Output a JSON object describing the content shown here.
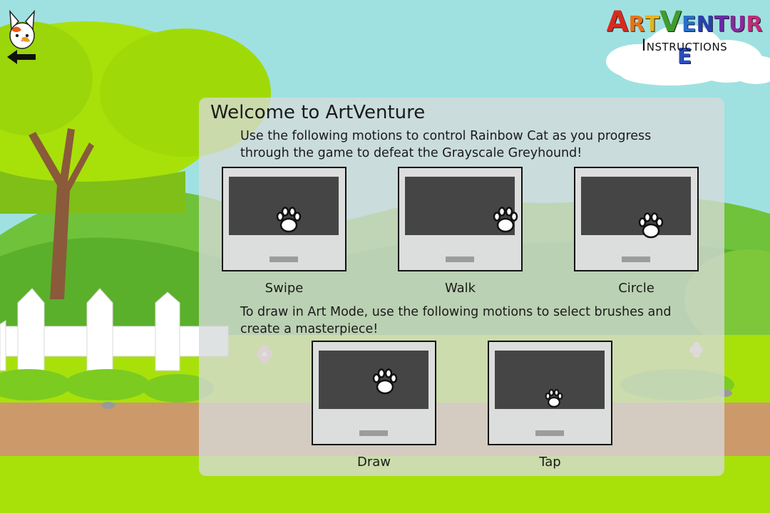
{
  "logo": {
    "title_letters": [
      {
        "ch": "A",
        "color": "#d62b1f"
      },
      {
        "ch": "R",
        "color": "#e8731a"
      },
      {
        "ch": "T",
        "color": "#e8b31a"
      },
      {
        "ch": "V",
        "color": "#3f9d2a"
      },
      {
        "ch": "E",
        "color": "#2a6fc9"
      },
      {
        "ch": "N",
        "color": "#2a3fb0"
      },
      {
        "ch": "T",
        "color": "#6a2aa8"
      },
      {
        "ch": "U",
        "color": "#8a2aa0"
      },
      {
        "ch": "R",
        "color": "#c02a7a"
      },
      {
        "ch": "E",
        "color": "#2a4fc0"
      }
    ],
    "subtitle": "Instructions"
  },
  "back_button": {
    "icon": "arrow-left-icon",
    "avatar": "rainbow-cat-icon"
  },
  "panel": {
    "title": "Welcome to ArtVenture",
    "intro": "Use the following motions to control Rainbow Cat as you progress through the game to defeat the Grayscale Greyhound!",
    "art_intro": "To draw in Art Mode, use the following motions to select brushes and create a masterpiece!",
    "game_motions": [
      {
        "label": "Swipe",
        "icon": "paw-icon"
      },
      {
        "label": "Walk",
        "icon": "paw-icon"
      },
      {
        "label": "Circle",
        "icon": "paw-icon"
      }
    ],
    "art_motions": [
      {
        "label": "Draw",
        "icon": "paw-icon"
      },
      {
        "label": "Tap",
        "icon": "paw-icon"
      }
    ]
  },
  "colors": {
    "sky": "#9fe1e1",
    "grass": "#a8e10a",
    "path": "#cc9a6a",
    "panel": "#d6dada",
    "screen": "#454545"
  }
}
